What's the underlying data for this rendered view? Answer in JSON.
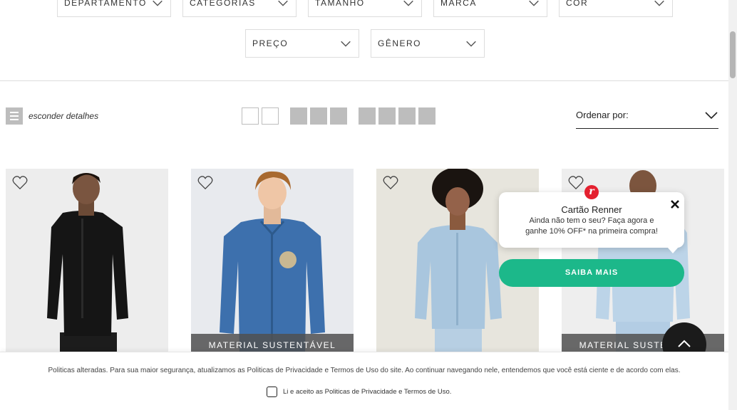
{
  "filters": {
    "row1": [
      {
        "label": "DEPARTAMENTO"
      },
      {
        "label": "CATEGORIAS"
      },
      {
        "label": "TAMANHO"
      },
      {
        "label": "MARCA"
      },
      {
        "label": "COR"
      }
    ],
    "row2": [
      {
        "label": "PREÇO"
      },
      {
        "label": "GÊNERO"
      }
    ]
  },
  "toolbar": {
    "details_label": "esconder detalhes",
    "sort_label": "Ordenar por:"
  },
  "products": [
    {
      "name": "product-black-shirt",
      "badge": ""
    },
    {
      "name": "product-denim-shirt",
      "badge": "MATERIAL SUSTENTÁVEL"
    },
    {
      "name": "product-light-blue-shirt",
      "badge": ""
    },
    {
      "name": "product-striped-shirt",
      "badge": "MATERIAL SUSTENTÁVEL"
    }
  ],
  "promo": {
    "logo": "r",
    "title": "Cartão Renner",
    "line1": "Ainda não tem o seu? Faça agora e",
    "line2": "ganhe 10% OFF* na primeira compra!",
    "cta": "SAIBA MAIS"
  },
  "cookie": {
    "text": "Politicas alteradas. Para sua maior segurança, atualizamos as Politicas de Privacidade e Termos de Uso do site. Ao continuar navegando nele, entendemos que você está ciente e de acordo com elas.",
    "accept_label": "Li e aceito as Politicas de Privacidade e Termos de Uso."
  },
  "colors": {
    "accent_green": "#1cb88a",
    "brand_red": "#e4202f",
    "icon_gray": "#bdbdbd"
  }
}
